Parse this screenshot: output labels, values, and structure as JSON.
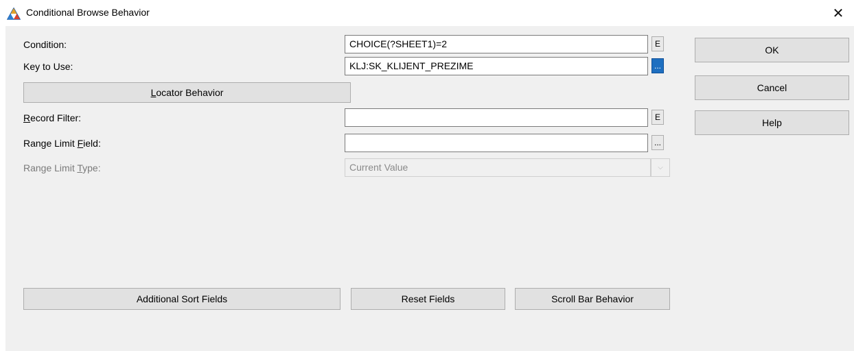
{
  "window": {
    "title": "Conditional Browse Behavior"
  },
  "form": {
    "condition_label": "Condition:",
    "condition_value": "CHOICE(?SHEET1)=2",
    "condition_btn": "E",
    "key_label": "Key to Use:",
    "key_value": "KLJ:SK_KLIJENT_PREZIME",
    "key_btn": "...",
    "locator_label_first": "L",
    "locator_label_rest": "ocator Behavior",
    "record_filter_label_first": "R",
    "record_filter_label_rest": "ecord Filter:",
    "record_filter_value": "",
    "record_filter_btn": "E",
    "range_field_label_pre": "Range Limit ",
    "range_field_label_u": "F",
    "range_field_label_post": "ield:",
    "range_field_value": "",
    "range_field_btn": "...",
    "range_type_label_pre": "Range Limit ",
    "range_type_label_u": "T",
    "range_type_label_post": "ype:",
    "range_type_value": "Current Value"
  },
  "buttons": {
    "ok": "OK",
    "cancel": "Cancel",
    "help": "Help",
    "additional_sort": "Additional Sort Fields",
    "reset_fields": "Reset Fields",
    "scroll_bar": "Scroll Bar Behavior"
  },
  "icons": {
    "app": "app-triangle-icon",
    "close": "close-icon",
    "dropdown": "chevron-down-icon"
  }
}
